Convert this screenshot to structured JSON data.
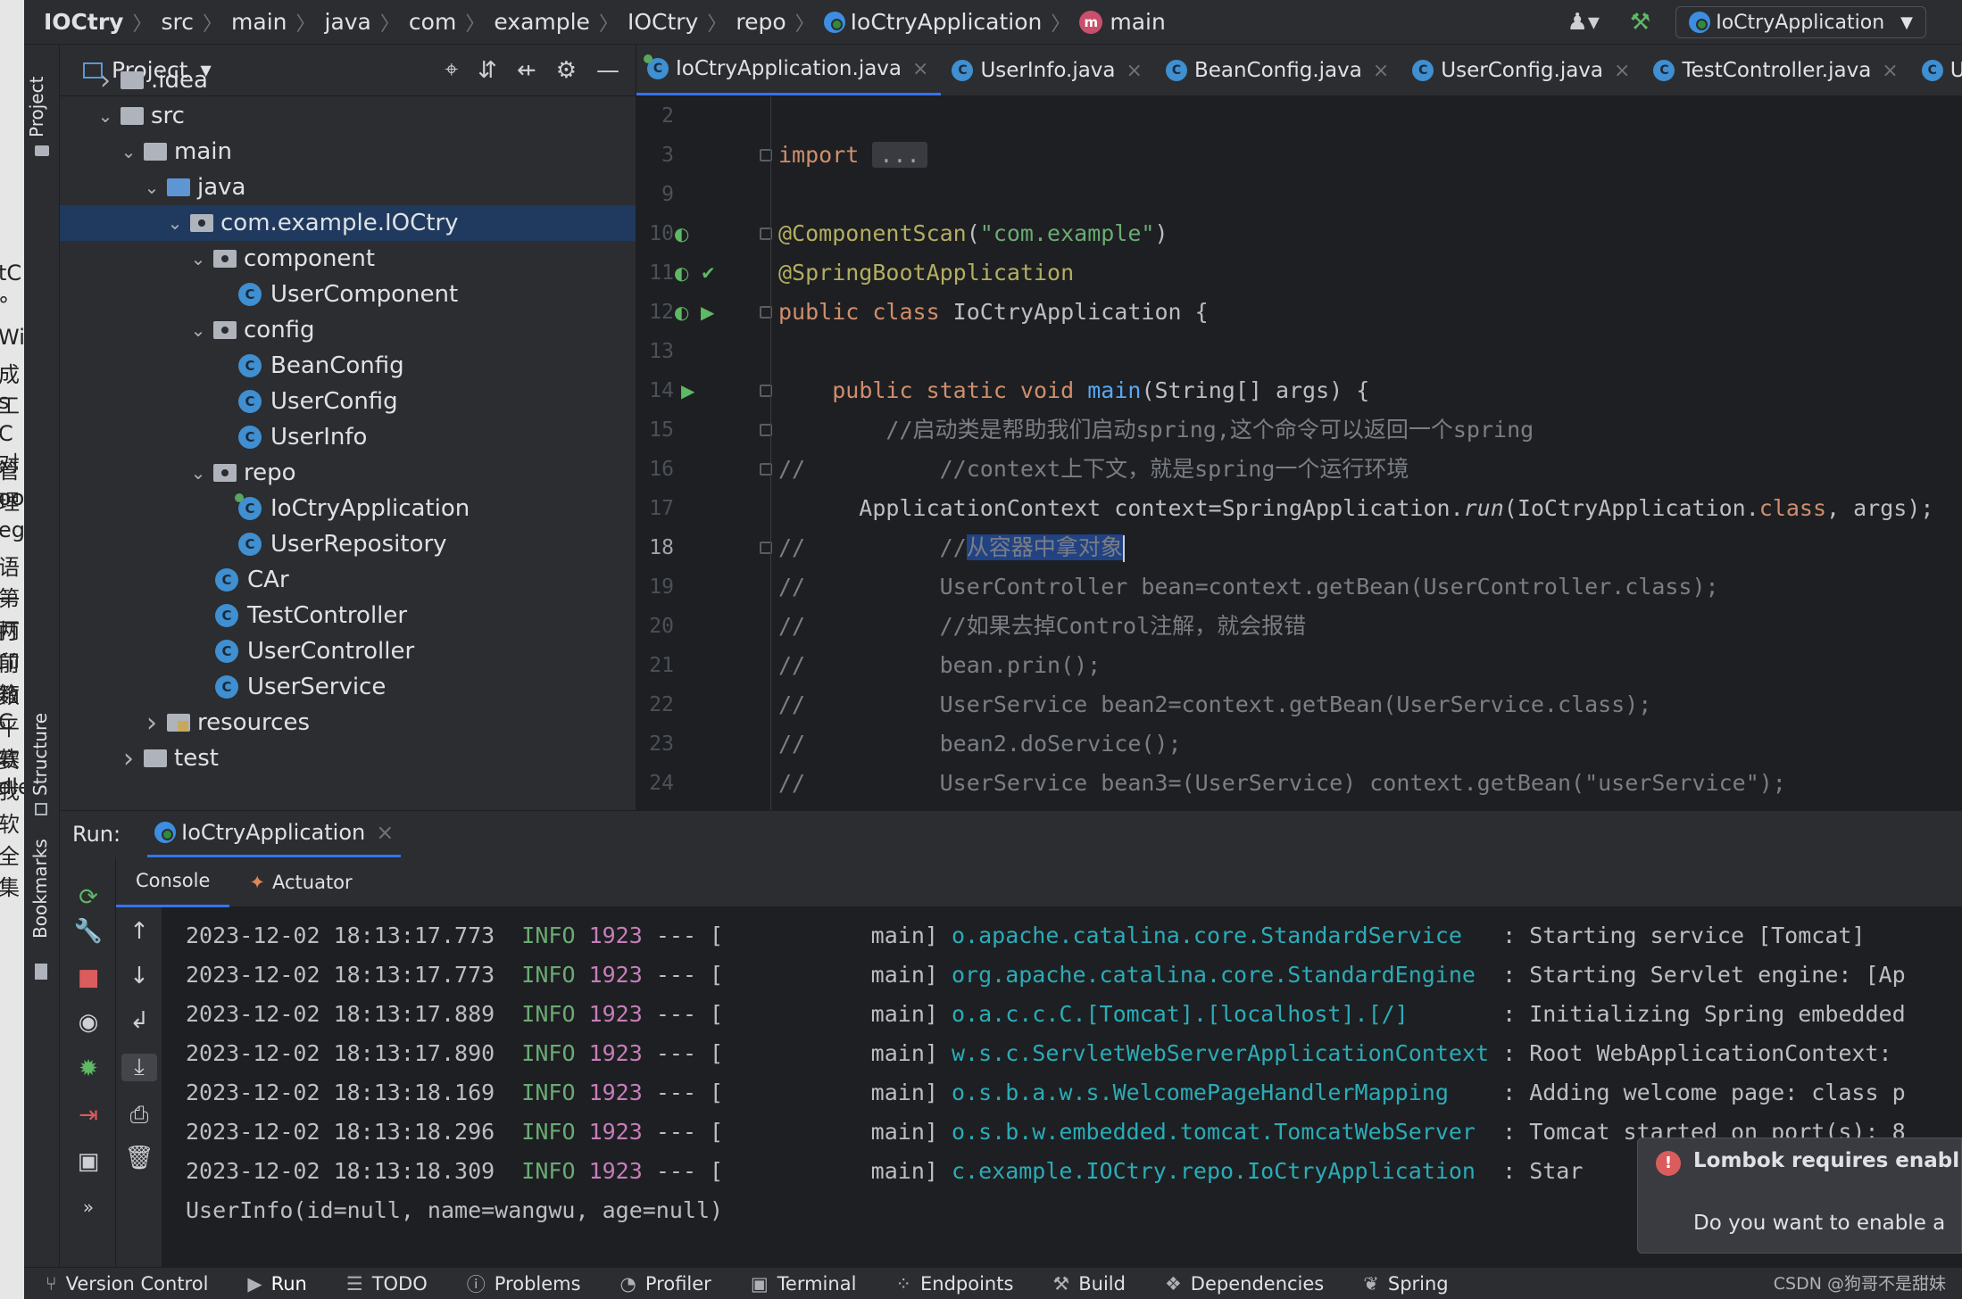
{
  "breadcrumb": [
    "IOCtry",
    "src",
    "main",
    "java",
    "com",
    "example",
    "IOCtry",
    "repo",
    "IoCtryApplication",
    "main"
  ],
  "run_config": "IoCtryApplication",
  "left_edge_chars": [
    "tC",
    "°",
    "Wi",
    "成工",
    "s",
    "C对",
    "管理",
    "oo",
    "eg",
    "语第",
    "一两",
    "打印",
    "前箱",
    "数C",
    "平软",
    "赛我",
    "dle",
    "软",
    "全集"
  ],
  "sidebar": {
    "project_tool": "Project",
    "structure_tool": "Structure",
    "bookmarks_tool": "Bookmarks"
  },
  "project_panel": {
    "title": "Project",
    "tree": [
      {
        "label": ".idea",
        "kind": "folder",
        "depth": 1,
        "expanded": false
      },
      {
        "label": "src",
        "kind": "folder",
        "depth": 1,
        "expanded": true
      },
      {
        "label": "main",
        "kind": "folder",
        "depth": 2,
        "expanded": true
      },
      {
        "label": "java",
        "kind": "folder-blue",
        "depth": 3,
        "expanded": true
      },
      {
        "label": "com.example.IOCtry",
        "kind": "package",
        "depth": 4,
        "expanded": true,
        "selected": true
      },
      {
        "label": "component",
        "kind": "package",
        "depth": 5,
        "expanded": true
      },
      {
        "label": "UserComponent",
        "kind": "class",
        "depth": 6
      },
      {
        "label": "config",
        "kind": "package",
        "depth": 5,
        "expanded": true
      },
      {
        "label": "BeanConfig",
        "kind": "class",
        "depth": 6
      },
      {
        "label": "UserConfig",
        "kind": "class",
        "depth": 6
      },
      {
        "label": "UserInfo",
        "kind": "class",
        "depth": 6
      },
      {
        "label": "repo",
        "kind": "package",
        "depth": 5,
        "expanded": true
      },
      {
        "label": "IoCtryApplication",
        "kind": "app",
        "depth": 6
      },
      {
        "label": "UserRepository",
        "kind": "class",
        "depth": 6
      },
      {
        "label": "CAr",
        "kind": "class",
        "depth": 5
      },
      {
        "label": "TestController",
        "kind": "class",
        "depth": 5
      },
      {
        "label": "UserController",
        "kind": "class",
        "depth": 5
      },
      {
        "label": "UserService",
        "kind": "class",
        "depth": 5
      },
      {
        "label": "resources",
        "kind": "resources",
        "depth": 3,
        "expanded": false
      },
      {
        "label": "test",
        "kind": "folder",
        "depth": 2,
        "expanded": false
      }
    ]
  },
  "editor_tabs": [
    {
      "label": "IoCtryApplication.java",
      "active": true
    },
    {
      "label": "UserInfo.java",
      "active": false
    },
    {
      "label": "BeanConfig.java",
      "active": false
    },
    {
      "label": "UserConfig.java",
      "active": false
    },
    {
      "label": "TestController.java",
      "active": false
    },
    {
      "label": "UserR",
      "active": false
    }
  ],
  "editor": {
    "current_line": "18",
    "lines": [
      {
        "n": "2",
        "html": ""
      },
      {
        "n": "3",
        "html": "<span class='kw'>import</span> <span class='fold-dots'>...</span>"
      },
      {
        "n": "9",
        "html": ""
      },
      {
        "n": "10",
        "html": "<span class='ann'>@ComponentScan</span>(<span class='str'>\"com.example\"</span>)"
      },
      {
        "n": "11",
        "html": "<span class='ann'>@SpringBootApplication</span>"
      },
      {
        "n": "12",
        "html": "<span class='kw'>public class</span> IoCtryApplication {"
      },
      {
        "n": "13",
        "html": ""
      },
      {
        "n": "14",
        "html": "    <span class='kw'>public static void</span> <span class='fn'>main</span>(String[] args) {"
      },
      {
        "n": "15",
        "html": "        <span class='cm'>//启动类是帮助我们启动spring,这个命令可以返回一个spring</span>"
      },
      {
        "n": "16",
        "html": "<span class='cm'>//          //context上下文，就是spring一个运行环境</span>"
      },
      {
        "n": "17",
        "html": "      ApplicationContext context=SpringApplication.<span class='it'>run</span>(IoCtryApplication.<span class='kw'>class</span>, args);"
      },
      {
        "n": "18",
        "html": "<span class='cm'>//          //<span class='sel-text'>从容器中拿对象</span></span><span class='caret'></span>"
      },
      {
        "n": "19",
        "html": "<span class='cm'>//          UserController bean=context.getBean(UserController.class);</span>"
      },
      {
        "n": "20",
        "html": "<span class='cm'>//          //如果去掉Control注解，就会报错</span>"
      },
      {
        "n": "21",
        "html": "<span class='cm'>//          bean.prin();</span>"
      },
      {
        "n": "22",
        "html": "<span class='cm'>//          UserService bean2=context.getBean(UserService.class);</span>"
      },
      {
        "n": "23",
        "html": "<span class='cm'>//          bean2.doService();</span>"
      },
      {
        "n": "24",
        "html": "<span class='cm'>//          UserService bean3=(UserService) context.getBean(\"userService\");</span>"
      }
    ]
  },
  "run_panel": {
    "label": "Run:",
    "tab": "IoCtryApplication",
    "subtabs": [
      "Console",
      "Actuator"
    ]
  },
  "console": {
    "lines": [
      {
        "ts": "2023-12-02 18:13:17.773",
        "level": "INFO",
        "pid": "1923",
        "sep": "--- [",
        "thread": "main]",
        "logger": "o.apache.catalina.core.StandardService",
        "msg": ": Starting service [Tomcat]"
      },
      {
        "ts": "2023-12-02 18:13:17.773",
        "level": "INFO",
        "pid": "1923",
        "sep": "--- [",
        "thread": "main]",
        "logger": "org.apache.catalina.core.StandardEngine",
        "msg": ": Starting Servlet engine: [Ap"
      },
      {
        "ts": "2023-12-02 18:13:17.889",
        "level": "INFO",
        "pid": "1923",
        "sep": "--- [",
        "thread": "main]",
        "logger": "o.a.c.c.C.[Tomcat].[localhost].[/]",
        "msg": ": Initializing Spring embedded"
      },
      {
        "ts": "2023-12-02 18:13:17.890",
        "level": "INFO",
        "pid": "1923",
        "sep": "--- [",
        "thread": "main]",
        "logger": "w.s.c.ServletWebServerApplicationContext",
        "msg": ": Root WebApplicationContext:"
      },
      {
        "ts": "2023-12-02 18:13:18.169",
        "level": "INFO",
        "pid": "1923",
        "sep": "--- [",
        "thread": "main]",
        "logger": "o.s.b.a.w.s.WelcomePageHandlerMapping",
        "msg": ": Adding welcome page: class p"
      },
      {
        "ts": "2023-12-02 18:13:18.296",
        "level": "INFO",
        "pid": "1923",
        "sep": "--- [",
        "thread": "main]",
        "logger": "o.s.b.w.embedded.tomcat.TomcatWebServer",
        "msg": ": Tomcat started on port(s): 8"
      },
      {
        "ts": "2023-12-02 18:13:18.309",
        "level": "INFO",
        "pid": "1923",
        "sep": "--- [",
        "thread": "main]",
        "logger": "c.example.IOCtry.repo.IoCtryApplication",
        "msg": ": Star"
      }
    ],
    "output": "UserInfo(id=null, name=wangwu, age=null)"
  },
  "notification": {
    "title": "Lombok requires enabl",
    "body": "Do you want to enable a"
  },
  "status_bar": [
    {
      "label": "Version Control",
      "icon": "branch-icon"
    },
    {
      "label": "Run",
      "icon": "run-icon",
      "active": true
    },
    {
      "label": "TODO",
      "icon": "list-icon"
    },
    {
      "label": "Problems",
      "icon": "info-icon"
    },
    {
      "label": "Profiler",
      "icon": "profiler-icon"
    },
    {
      "label": "Terminal",
      "icon": "terminal-icon"
    },
    {
      "label": "Endpoints",
      "icon": "endpoints-icon"
    },
    {
      "label": "Build",
      "icon": "hammer-icon"
    },
    {
      "label": "Dependencies",
      "icon": "stack-icon"
    },
    {
      "label": "Spring",
      "icon": "leaf-icon"
    }
  ],
  "watermark": "CSDN @狗哥不是甜妹",
  "colors": {
    "accent": "#3574f0",
    "selection": "#1f3a5e",
    "editor_bg": "#1e1f22",
    "panel_bg": "#2b2d30"
  }
}
